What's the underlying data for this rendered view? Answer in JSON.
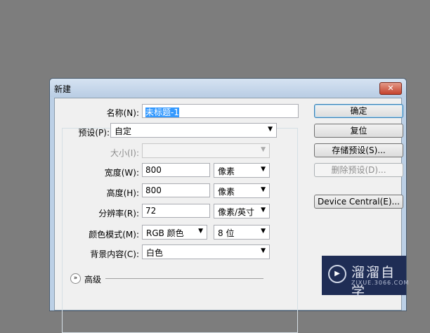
{
  "dialog": {
    "title": "新建",
    "close": "✕"
  },
  "fields": {
    "name_label": "名称(N):",
    "name_value": "未标题-1",
    "preset_label": "预设(P):",
    "preset_value": "自定",
    "size_label": "大小(I):",
    "size_value": "",
    "width_label": "宽度(W):",
    "width_value": "800",
    "width_unit": "像素",
    "height_label": "高度(H):",
    "height_value": "800",
    "height_unit": "像素",
    "res_label": "分辨率(R):",
    "res_value": "72",
    "res_unit": "像素/英寸",
    "mode_label": "颜色模式(M):",
    "mode_value": "RGB 颜色",
    "depth_value": "8 位",
    "bg_label": "背景内容(C):",
    "bg_value": "白色",
    "advanced": "高级"
  },
  "buttons": {
    "ok": "确定",
    "reset": "复位",
    "save": "存储预设(S)...",
    "delete": "删除预设(D)...",
    "device": "Device Central(E)..."
  },
  "watermark": {
    "name": "溜溜自学",
    "url": "ZIXUE.3066.COM"
  }
}
